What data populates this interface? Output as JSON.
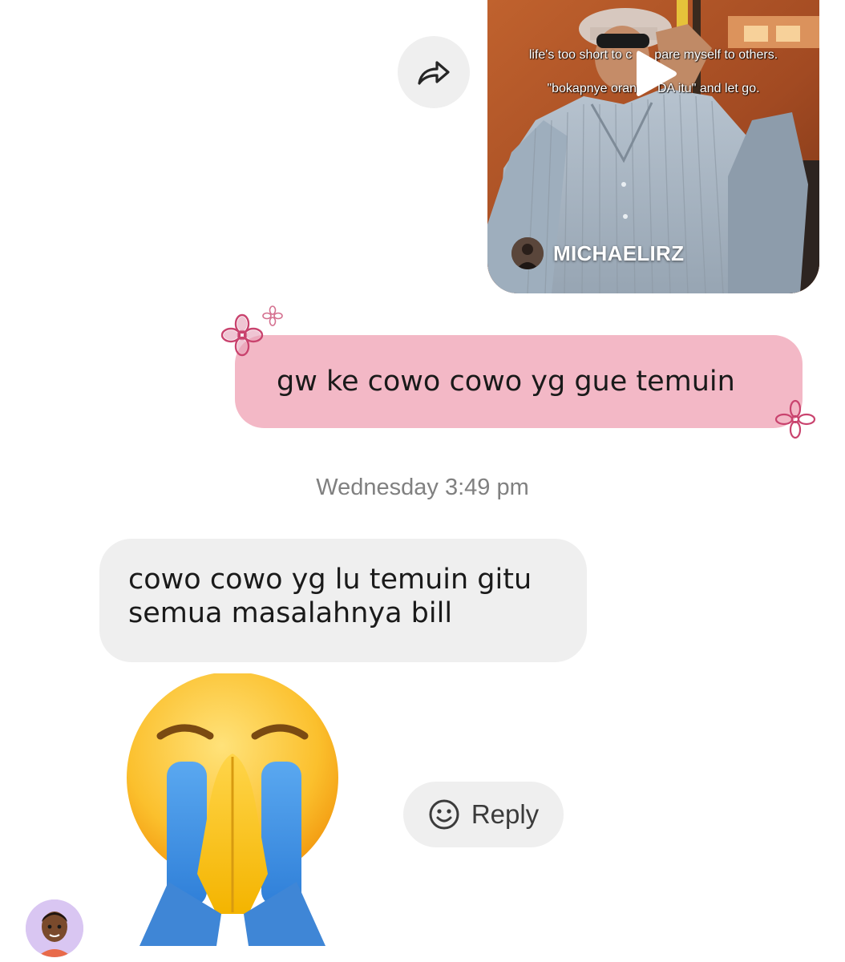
{
  "shared_reel": {
    "caption_lines": [
      "life's too short to c",
      "pare myself to others.",
      "j",
      "\"bokapnye oran",
      "DA itu\" and let go."
    ],
    "username": "MICHAELIRZ",
    "play_icon": "play-icon",
    "share_icon": "share-arrow-icon"
  },
  "sent_message": {
    "text": "gw ke cowo cowo yg gue temuin",
    "bubble_color": "#f3b8c6",
    "decoration_icon": "flower-doodle-icon"
  },
  "timestamp": "Wednesday 3:49 pm",
  "received_message": {
    "lines": [
      "cowo cowo yg lu temuin gitu",
      "semua masalahnya bill"
    ]
  },
  "emoji_reaction": {
    "icon": "crying-praying-emoji"
  },
  "reply_button": {
    "label": "Reply",
    "icon": "smiley-icon"
  },
  "sender_avatar": {
    "icon": "memoji-avatar"
  }
}
